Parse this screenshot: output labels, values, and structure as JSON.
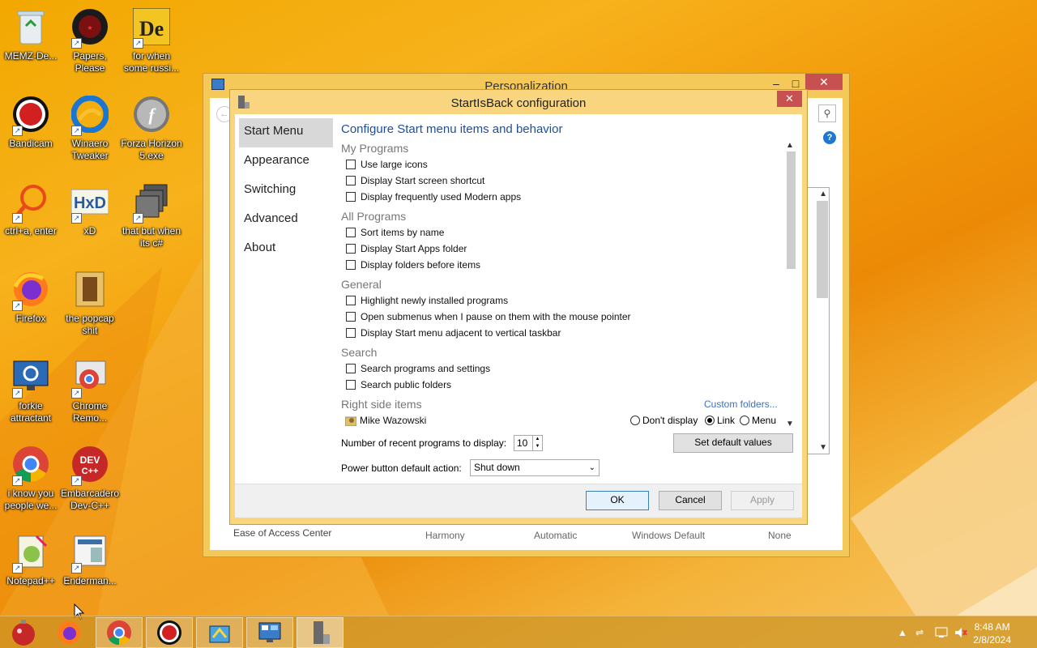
{
  "desktop": {
    "icons": [
      {
        "label": "MEMZ-De...",
        "icon": "recycle-bin-icon"
      },
      {
        "label": "Papers, Please",
        "icon": "papers-please-icon"
      },
      {
        "label": "for when some russi...",
        "icon": "de-game-icon"
      },
      {
        "label": "Bandicam",
        "icon": "bandicam-icon"
      },
      {
        "label": "Winaero Tweaker",
        "icon": "winaero-tweaker-icon"
      },
      {
        "label": "Forza Horizon 5.exe",
        "icon": "flash-icon"
      },
      {
        "label": "ctrl+a, enter",
        "icon": "search-icon"
      },
      {
        "label": "xD",
        "icon": "hxd-icon"
      },
      {
        "label": "that but when its c#",
        "icon": "windows-stack-icon"
      },
      {
        "label": "Firefox",
        "icon": "firefox-icon"
      },
      {
        "label": "the popcap shit",
        "icon": "popcap-icon"
      },
      {
        "label": "forkie attractant",
        "icon": "monitor-gear-icon"
      },
      {
        "label": "Chrome Remo...",
        "icon": "chrome-remote-icon"
      },
      {
        "label": "i know you people we...",
        "icon": "chrome-icon"
      },
      {
        "label": "Embarcadero Dev-C++",
        "icon": "devcpp-icon"
      },
      {
        "label": "Notepad++",
        "icon": "notepadpp-icon"
      },
      {
        "label": "Enderman...",
        "icon": "document-icon"
      }
    ]
  },
  "personalization": {
    "title": "Personalization",
    "bottom_items": [
      "Ease of Access Center",
      "Harmony",
      "Automatic",
      "Windows Default",
      "None"
    ]
  },
  "dialog": {
    "title": "StartIsBack configuration",
    "nav": [
      "Start Menu",
      "Appearance",
      "Switching",
      "Advanced",
      "About"
    ],
    "heading": "Configure Start menu items and behavior",
    "sections": {
      "my_programs": {
        "title": "My Programs",
        "items": [
          "Use large icons",
          "Display Start screen shortcut",
          "Display frequently used Modern apps"
        ]
      },
      "all_programs": {
        "title": "All Programs",
        "items": [
          "Sort items by name",
          "Display Start Apps folder",
          "Display folders before items"
        ]
      },
      "general": {
        "title": "General",
        "items": [
          "Highlight newly installed programs",
          "Open submenus when I pause on them with the mouse pointer",
          "Display Start menu adjacent to vertical taskbar"
        ]
      },
      "search": {
        "title": "Search",
        "items": [
          "Search programs and settings",
          "Search public folders"
        ]
      },
      "right_side": {
        "title": "Right side items",
        "custom_link": "Custom folders...",
        "item": "Mike Wazowski",
        "options": [
          "Don't display",
          "Link",
          "Menu"
        ],
        "selected": "Link"
      }
    },
    "recent_label": "Number of recent programs to display:",
    "recent_value": "10",
    "set_default": "Set default values",
    "power_label": "Power button default action:",
    "power_value": "Shut down",
    "ok": "OK",
    "cancel": "Cancel",
    "apply": "Apply"
  },
  "taskbar": {
    "time": "8:48 AM",
    "date": "2/8/2024"
  }
}
